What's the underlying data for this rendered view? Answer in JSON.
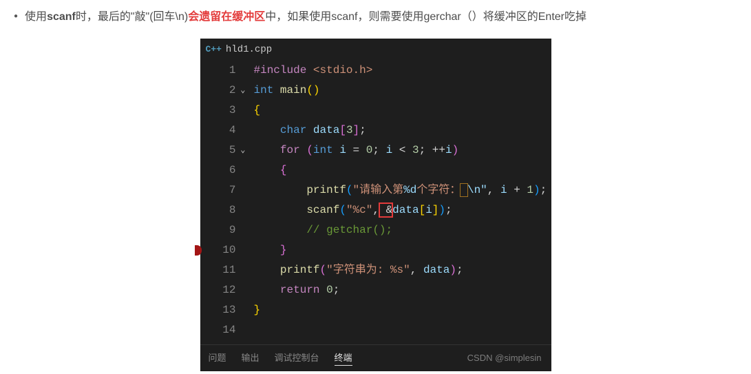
{
  "bullet": {
    "prefix": "使用",
    "bold1": "scanf",
    "mid1": "时，最后的\"敲\"(回车\\n)",
    "red": "会遗留在缓冲区",
    "mid2": "中，如果使用scanf，则需要使用gerchar（）将缓冲区的Enter吃掉"
  },
  "tab": {
    "lang": "C++",
    "file": "hld1.cpp"
  },
  "lines": {
    "l1_include": "#include",
    "l1_lib": " <stdio.h>",
    "l2_int": "int",
    "l2_main": " main",
    "l2_p": "()",
    "l3": "{",
    "l4_char": "char",
    "l4_var": " data",
    "l4_b1": "[",
    "l4_n": "3",
    "l4_b2": "]",
    "l4_sc": ";",
    "l5_for": "for",
    "l5_o": " (",
    "l5_int": "int",
    "l5_i": " i",
    "l5_eq": " = ",
    "l5_z": "0",
    "l5_sc1": "; ",
    "l5_i2": "i",
    "l5_lt": " < ",
    "l5_3": "3",
    "l5_sc2": "; ++",
    "l5_i3": "i",
    "l5_c": ")",
    "l6": "{",
    "l7_fn": "printf",
    "l7_o": "(",
    "l7_s1": "\"请输入第",
    "l7_s2": "%d",
    "l7_s3": "个字符：",
    "l7_s4": "\\n\"",
    "l7_cm": ", ",
    "l7_i": "i",
    "l7_pl": " + ",
    "l7_1": "1",
    "l7_c": ")",
    "l7_sc": ";",
    "l8_fn": "scanf",
    "l8_o": "(",
    "l8_s": "\"%c\"",
    "l8_cm": ",",
    "l8_sp": " ",
    "l8_amp": "&",
    "l8_d": "data",
    "l8_b1": "[",
    "l8_i": "i",
    "l8_b2": "]",
    "l8_c": ")",
    "l8_sc": ";",
    "l9": "// getchar();",
    "l10": "}",
    "l11_fn": "printf",
    "l11_o": "(",
    "l11_s": "\"字符串为: %s\"",
    "l11_cm": ", ",
    "l11_d": "data",
    "l11_c": ")",
    "l11_sc": ";",
    "l12_r": "return",
    "l12_z": " 0",
    "l12_sc": ";",
    "l13": "}"
  },
  "gutter": [
    "1",
    "2",
    "3",
    "4",
    "5",
    "6",
    "7",
    "8",
    "9",
    "10",
    "11",
    "12",
    "13",
    "14"
  ],
  "panel": {
    "t1": "问题",
    "t2": "输出",
    "t3": "调试控制台",
    "t4": "终端"
  },
  "watermark": "CSDN @simplesin"
}
